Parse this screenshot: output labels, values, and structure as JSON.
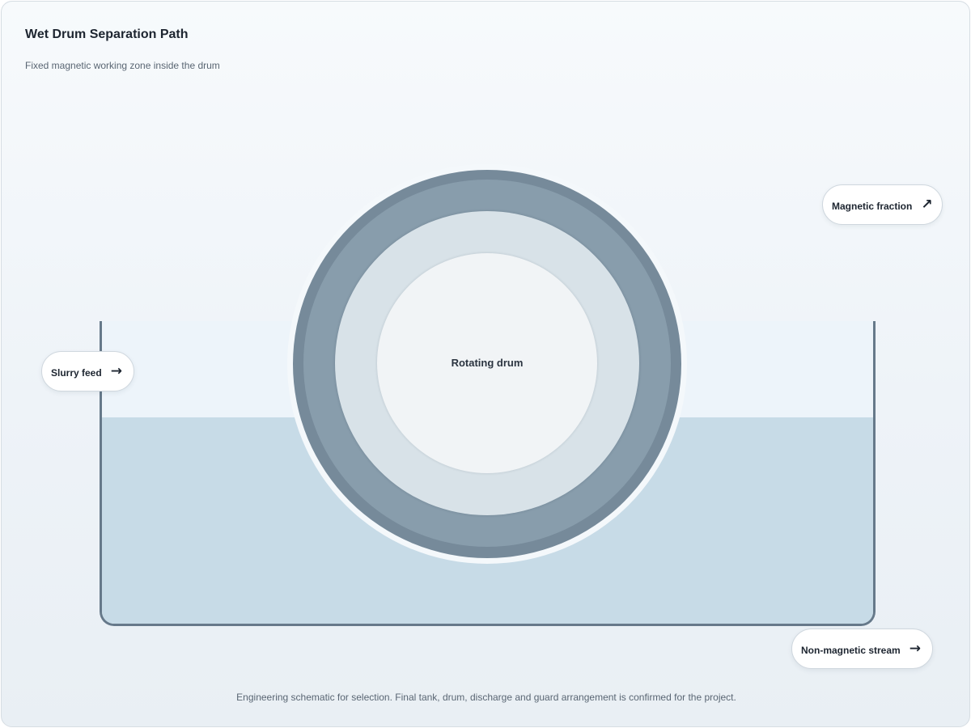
{
  "header": {
    "title": "Wet Drum Separation Path",
    "subtitle": "Fixed magnetic working zone inside the drum"
  },
  "drum": {
    "label": "Rotating drum"
  },
  "callouts": {
    "slurry_feed": {
      "label": "Slurry feed",
      "icon": "arrow-right-icon",
      "glyph": "→"
    },
    "magnetic_fraction": {
      "label": "Magnetic fraction",
      "icon": "arrow-up-right-icon",
      "glyph": "↗"
    },
    "non_magnetic_stream": {
      "label": "Non-magnetic stream",
      "icon": "arrow-right-icon",
      "glyph": "→"
    }
  },
  "footer": {
    "note": "Engineering schematic for selection. Final tank, drum, discharge and guard arrangement is confirmed for the project."
  },
  "colors": {
    "tank_wall": "#66798a",
    "slurry": "#c7dbe7",
    "drum_shell": "#768a9a",
    "drum_ring": "#889dac",
    "magnetic_zone": "#d8e2e8",
    "drum_core": "#f1f4f6"
  }
}
